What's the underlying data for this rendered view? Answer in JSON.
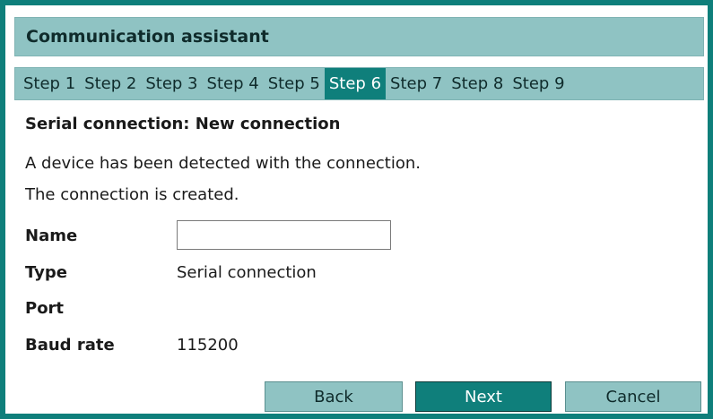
{
  "window": {
    "title": "Communication assistant"
  },
  "steps": {
    "items": [
      "Step 1",
      "Step 2",
      "Step 3",
      "Step 4",
      "Step 5",
      "Step 6",
      "Step 7",
      "Step 8",
      "Step 9"
    ],
    "active_index": 5
  },
  "content": {
    "heading": "Serial connection: New connection",
    "description_line1": "A device has been detected with the connection.",
    "description_line2": "The connection is created."
  },
  "form": {
    "name_label": "Name",
    "name_value": "",
    "type_label": "Type",
    "type_value": "Serial connection",
    "port_label": "Port",
    "port_value": "",
    "baud_label": "Baud rate",
    "baud_value": "115200"
  },
  "buttons": {
    "back": "Back",
    "next": "Next",
    "cancel": "Cancel"
  },
  "colors": {
    "frame": "#0f7f7b",
    "header_bg": "#8fc3c3",
    "active_step_bg": "#0f7f7b",
    "primary_button": "#0f7f7b",
    "secondary_button": "#8fc3c3"
  }
}
